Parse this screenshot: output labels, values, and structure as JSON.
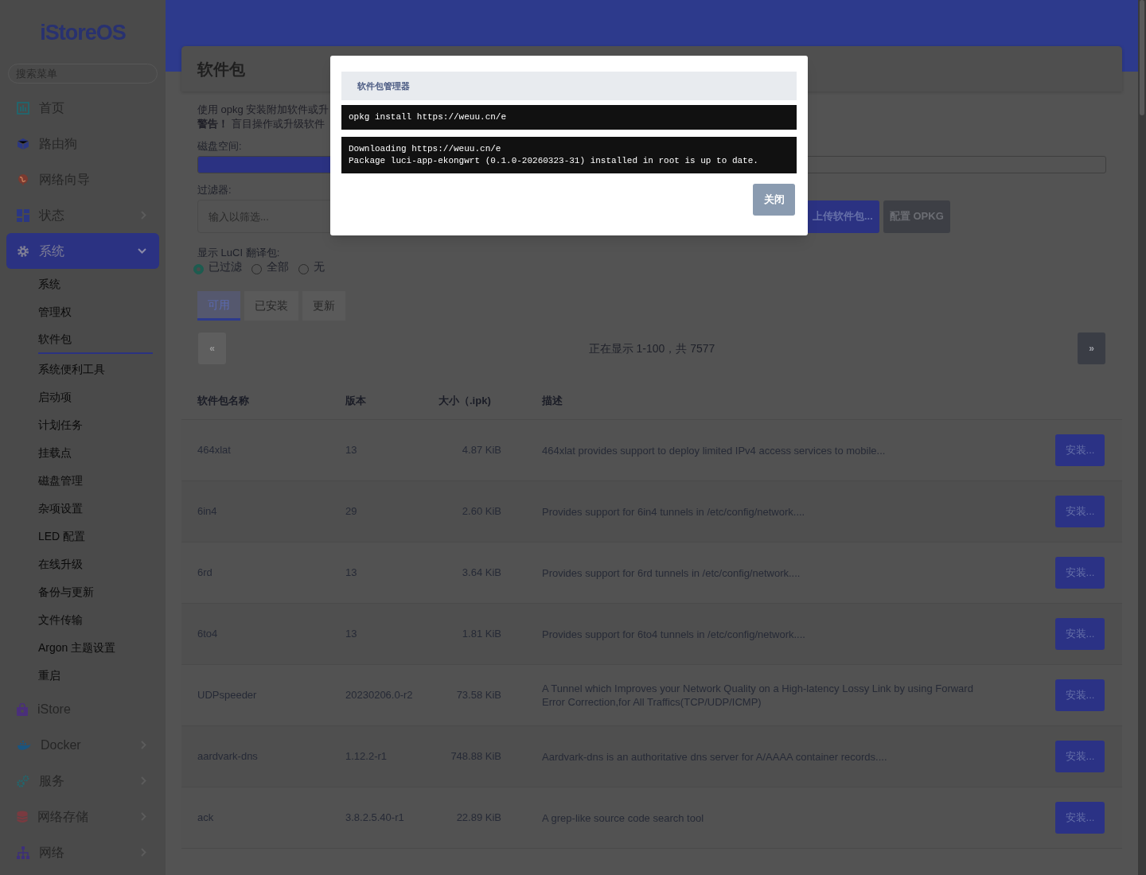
{
  "sidebar": {
    "logo": "iStoreOS",
    "search": {
      "placeholder": "搜索菜单"
    },
    "items": [
      {
        "label": "首页",
        "kind": "link",
        "selected": false
      },
      {
        "label": "路由狗",
        "kind": "link",
        "selected": false
      },
      {
        "label": "网络向导",
        "kind": "link",
        "selected": false
      },
      {
        "label": "状态",
        "kind": "group",
        "expanded": false,
        "selected": false
      },
      {
        "label": "系统",
        "kind": "group",
        "expanded": true,
        "selected": true,
        "children": [
          {
            "label": "系统",
            "selected": false
          },
          {
            "label": "管理权",
            "selected": false
          },
          {
            "label": "软件包",
            "selected": true
          },
          {
            "label": "系统便利工具",
            "selected": false
          },
          {
            "label": "启动项",
            "selected": false
          },
          {
            "label": "计划任务",
            "selected": false
          },
          {
            "label": "挂载点",
            "selected": false
          },
          {
            "label": "磁盘管理",
            "selected": false
          },
          {
            "label": "杂项设置",
            "selected": false
          },
          {
            "label": "LED 配置",
            "selected": false
          },
          {
            "label": "在线升级",
            "selected": false
          },
          {
            "label": "备份与更新",
            "selected": false
          },
          {
            "label": "文件传输",
            "selected": false
          },
          {
            "label": "Argon 主题设置",
            "selected": false
          },
          {
            "label": "重启",
            "selected": false
          }
        ]
      },
      {
        "label": "iStore",
        "kind": "link",
        "selected": false
      },
      {
        "label": "Docker",
        "kind": "group",
        "expanded": false,
        "selected": false
      },
      {
        "label": "服务",
        "kind": "group",
        "expanded": false,
        "selected": false
      },
      {
        "label": "网络存储",
        "kind": "group",
        "expanded": false,
        "selected": false
      },
      {
        "label": "网络",
        "kind": "group",
        "expanded": false,
        "selected": false
      }
    ]
  },
  "page": {
    "title": "软件包",
    "intro": [
      "使用 opkg 安装附加软件或升",
      "**警告！** 盲目操作或升级软件"
    ],
    "disk": {
      "label": "磁盘空间:",
      "level": 0.4
    },
    "filter": {
      "label": "过滤器:",
      "placeholder": "输入以筛选..."
    },
    "actions": [
      {
        "label": "上传软件包...",
        "kind": "primary"
      },
      {
        "label": "配置 OPKG",
        "kind": "secondary"
      }
    ],
    "translations": {
      "label": "显示 LuCI 翻译包:",
      "options": [
        {
          "label": "已过滤",
          "selected": true
        },
        {
          "label": "全部",
          "selected": false
        },
        {
          "label": "无",
          "selected": false
        }
      ]
    },
    "tabs": [
      {
        "label": "可用",
        "selected": true
      },
      {
        "label": "已安装",
        "selected": false
      },
      {
        "label": "更新",
        "selected": false
      }
    ],
    "pager": {
      "prev": {
        "label": "«",
        "disabled": true
      },
      "status": "正在显示 1-100，共 7577",
      "next": {
        "label": "»",
        "disabled": false
      }
    },
    "table": {
      "columns": [
        "软件包名称",
        "版本",
        "大小（.ipk)",
        "描述"
      ],
      "rows": [
        {
          "name": "464xlat",
          "version": "13",
          "size": "4.87 KiB",
          "description": "464xlat provides support to deploy limited IPv4 access services to mobile...",
          "action": "安装..."
        },
        {
          "name": "6in4",
          "version": "29",
          "size": "2.60 KiB",
          "description": "Provides support for 6in4 tunnels in /etc/config/network....",
          "action": "安装..."
        },
        {
          "name": "6rd",
          "version": "13",
          "size": "3.64 KiB",
          "description": "Provides support for 6rd tunnels in /etc/config/network....",
          "action": "安装..."
        },
        {
          "name": "6to4",
          "version": "13",
          "size": "1.81 KiB",
          "description": "Provides support for 6to4 tunnels in /etc/config/network....",
          "action": "安装..."
        },
        {
          "name": "UDPspeeder",
          "version": "20230206.0-r2",
          "size": "73.58 KiB",
          "description": "A Tunnel which Improves your Network Quality on a High-latency Lossy Link by using Forward Error Correction,for All Traffics(TCP/UDP/ICMP)",
          "action": "安装..."
        },
        {
          "name": "aardvark-dns",
          "version": "1.12.2-r1",
          "size": "748.88 KiB",
          "description": "Aardvark-dns is an authoritative dns server for A/AAAA container records....",
          "action": "安装..."
        },
        {
          "name": "ack",
          "version": "3.8.2.5.40-r1",
          "size": "22.89 KiB",
          "description": "A grep-like source code search tool",
          "action": "安装..."
        }
      ]
    }
  },
  "dialog": {
    "title": "软件包管理器",
    "command": "opkg install https://weuu.cn/e",
    "output": "Downloading https://weuu.cn/e\nPackage luci-app-ekongwrt (0.1.0-20260323-31) installed in root is up to date.",
    "close": "关闭"
  }
}
